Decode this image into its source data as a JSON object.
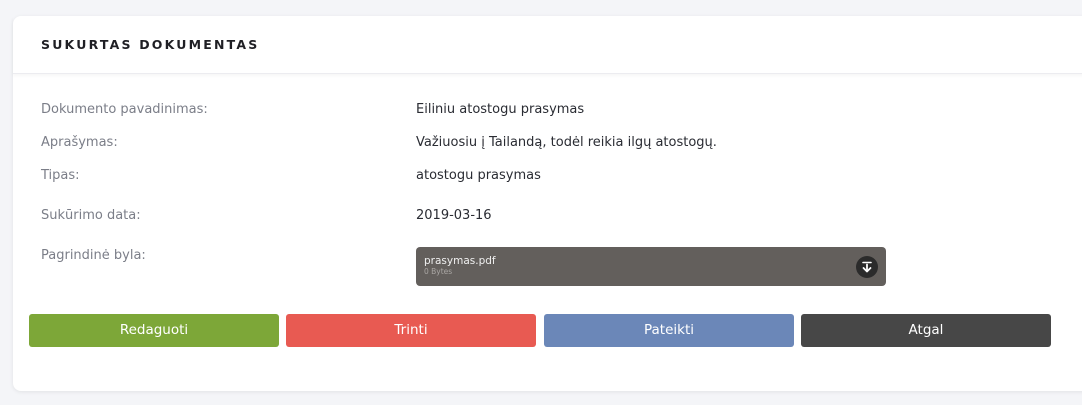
{
  "card": {
    "title": "SUKURTAS DOKUMENTAS"
  },
  "fields": {
    "name": {
      "label": "Dokumento pavadinimas:",
      "value": "Eiliniu atostogu prasymas"
    },
    "description": {
      "label": "Aprašymas:",
      "value": "Važiuosiu į Tailandą, todėl reikia ilgų atostogų."
    },
    "type": {
      "label": "Tipas:",
      "value": "atostogu prasymas"
    },
    "created": {
      "label": "Sukūrimo data:",
      "value": "2019-03-16"
    },
    "main_file": {
      "label": "Pagrindinė byla:"
    }
  },
  "file": {
    "name": "prasymas.pdf",
    "size": "0 Bytes",
    "icon": "download-icon"
  },
  "buttons": {
    "edit": "Redaguoti",
    "delete": "Trinti",
    "submit": "Pateikti",
    "back": "Atgal"
  },
  "colors": {
    "edit": "#7da738",
    "delete": "#e85a52",
    "submit": "#6b87b8",
    "back": "#474747",
    "file_box": "#635f5c"
  }
}
